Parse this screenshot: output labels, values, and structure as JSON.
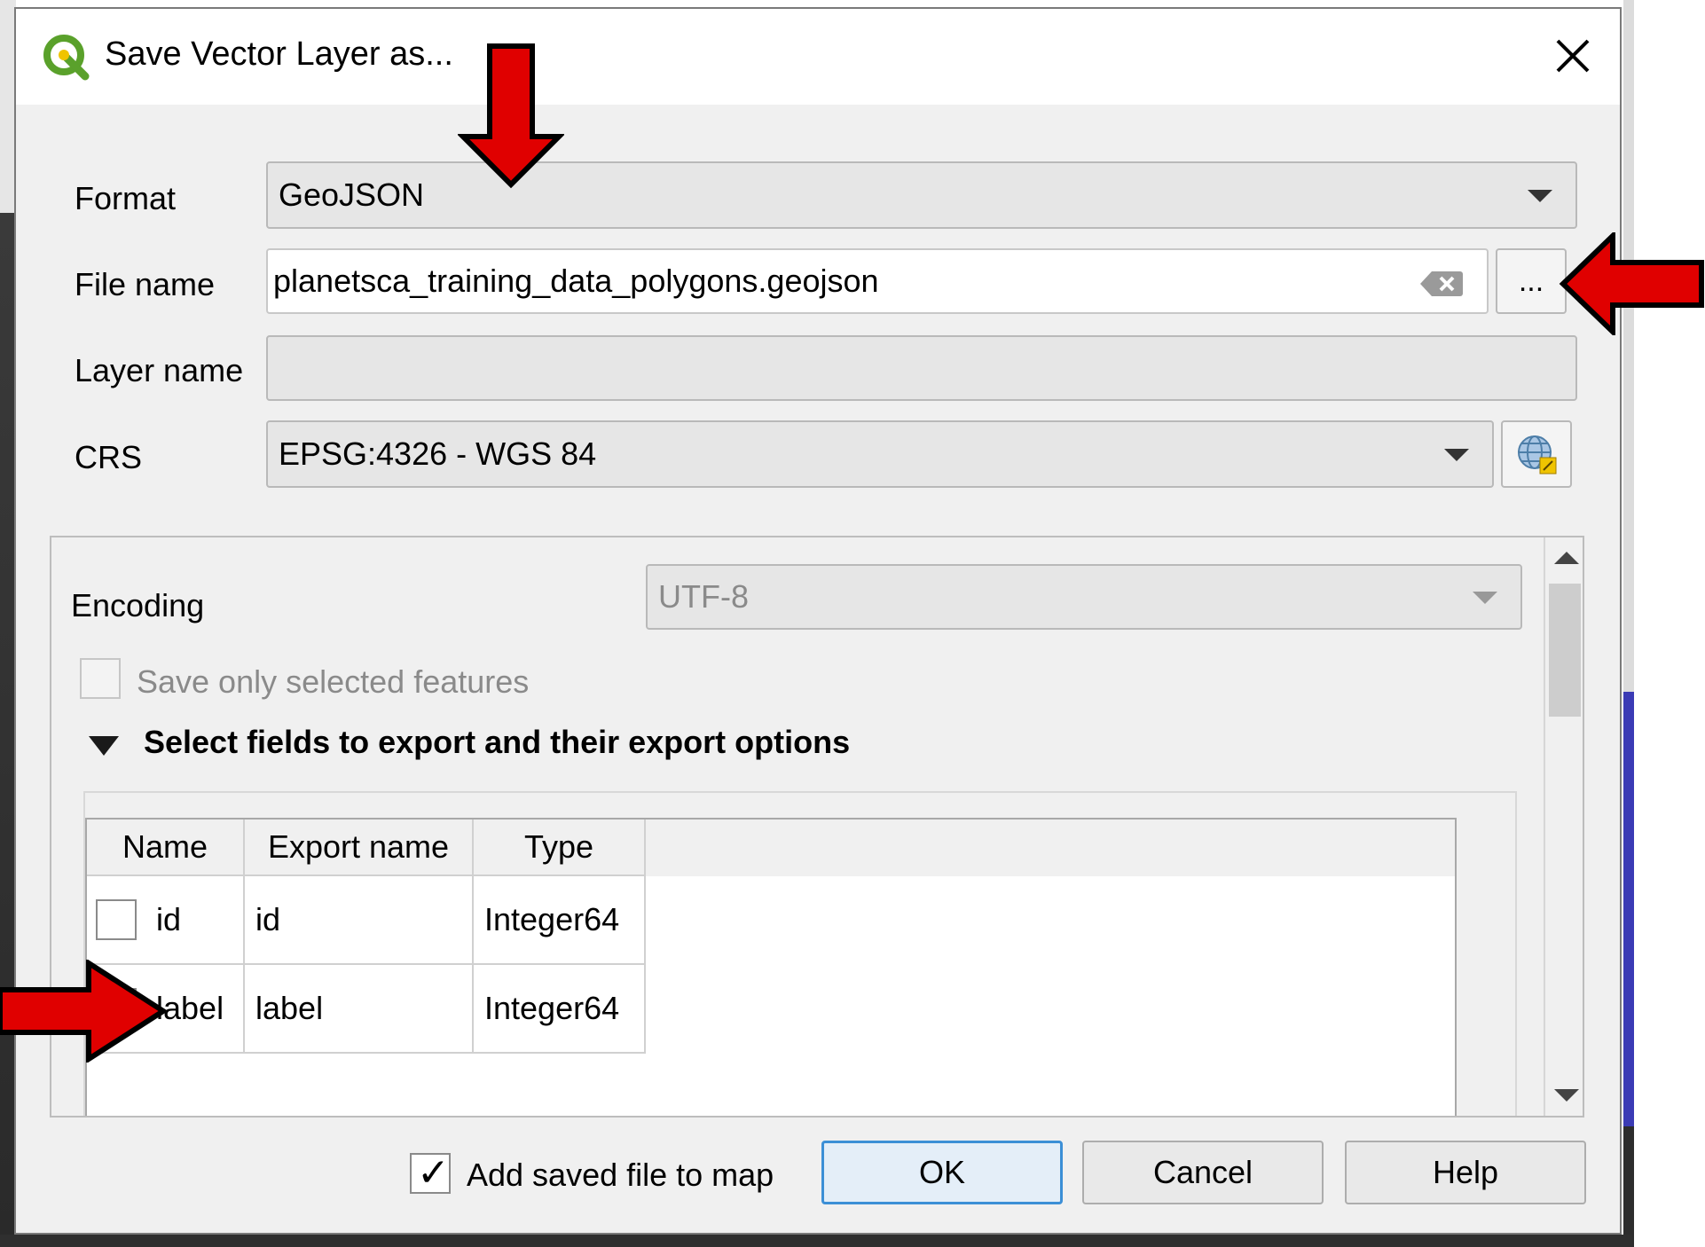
{
  "dialog": {
    "title": "Save Vector Layer as..."
  },
  "form": {
    "format_label": "Format",
    "format_value": "GeoJSON",
    "filename_label": "File name",
    "filename_value": "planetsca_training_data_polygons.geojson",
    "browse_label": "...",
    "layername_label": "Layer name",
    "layername_value": "",
    "crs_label": "CRS",
    "crs_value": "EPSG:4326 - WGS 84"
  },
  "options": {
    "encoding_label": "Encoding",
    "encoding_value": "UTF-8",
    "save_selected_label": "Save only selected features",
    "save_selected_checked": false,
    "fields_section_label": "Select fields to export and their export options"
  },
  "fields_table": {
    "columns": [
      "Name",
      "Export name",
      "Type"
    ],
    "rows": [
      {
        "name": "id",
        "export_name": "id",
        "type": "Integer64",
        "checked": false
      },
      {
        "name": "label",
        "export_name": "label",
        "type": "Integer64",
        "checked": true
      }
    ]
  },
  "footer": {
    "add_to_map_label": "Add saved file to map",
    "add_to_map_checked": true,
    "ok_label": "OK",
    "cancel_label": "Cancel",
    "help_label": "Help"
  },
  "colors": {
    "annotation_arrow": "#e00000",
    "accent_border": "#3c8fd6",
    "qgis_green": "#5aa12b",
    "qgis_yellow": "#f0c400"
  }
}
